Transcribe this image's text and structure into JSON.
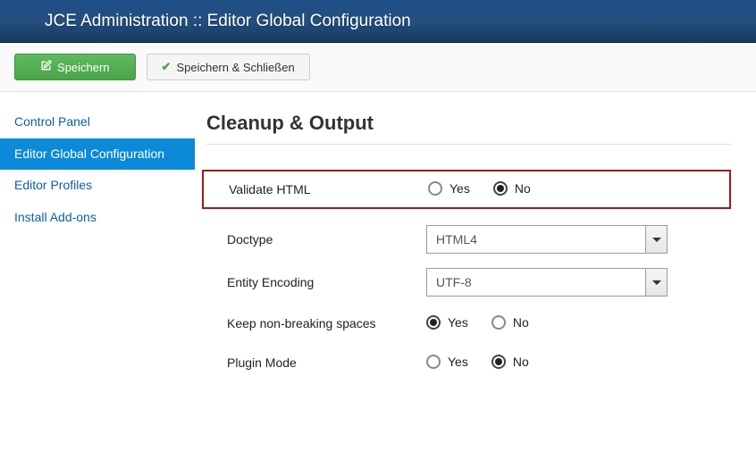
{
  "header": {
    "title": "JCE Administration :: Editor Global Configuration"
  },
  "toolbar": {
    "save_label": "Speichern",
    "save_close_label": "Speichern & Schließen"
  },
  "sidebar": {
    "items": [
      {
        "label": "Control Panel",
        "active": false
      },
      {
        "label": "Editor Global Configuration",
        "active": true
      },
      {
        "label": "Editor Profiles",
        "active": false
      },
      {
        "label": "Install Add-ons",
        "active": false
      }
    ]
  },
  "section": {
    "title": "Cleanup & Output"
  },
  "options": {
    "yes": "Yes",
    "no": "No"
  },
  "fields": {
    "validate_html": {
      "label": "Validate HTML",
      "value": "No"
    },
    "doctype": {
      "label": "Doctype",
      "value": "HTML4"
    },
    "entity_encoding": {
      "label": "Entity Encoding",
      "value": "UTF-8"
    },
    "keep_nbsp": {
      "label": "Keep non-breaking spaces",
      "value": "Yes"
    },
    "plugin_mode": {
      "label": "Plugin Mode",
      "value": "No"
    }
  }
}
